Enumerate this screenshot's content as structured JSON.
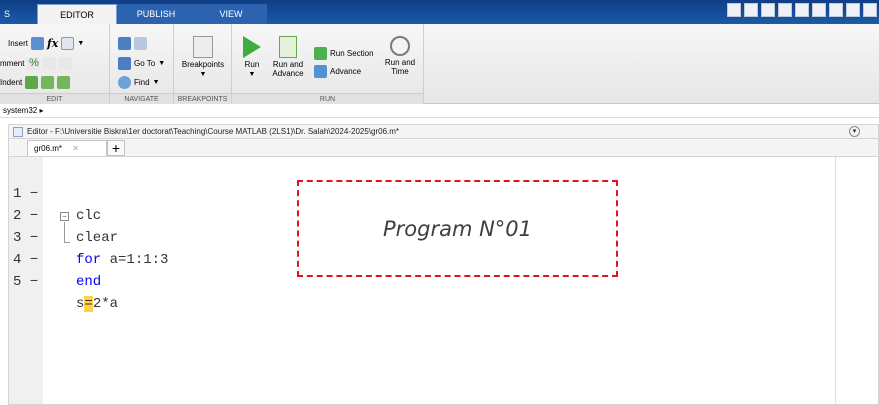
{
  "tabs": {
    "left_stub": "S",
    "editor": "EDITOR",
    "publish": "PUBLISH",
    "view": "VIEW"
  },
  "toolstrip": {
    "edit": {
      "label": "EDIT",
      "insert": "Insert",
      "fx": "fx",
      "comment": "mment",
      "indent": "Indent"
    },
    "navigate": {
      "label": "NAVIGATE",
      "goto": "Go To",
      "find": "Find"
    },
    "breakpoints": {
      "label": "BREAKPOINTS",
      "breakpoints": "Breakpoints"
    },
    "run": {
      "label": "RUN",
      "run": "Run",
      "run_and_advance_1": "Run and",
      "run_and_advance_2": "Advance",
      "run_section": "Run Section",
      "advance": "Advance",
      "run_and_time_1": "Run and",
      "run_and_time_2": "Time"
    }
  },
  "breadcrumb": "system32 ▸",
  "editor": {
    "title": "Editor - F:\\Universitie Biskra\\1er doctorat\\Teaching\\Course MATLAB (2LS1)\\Dr. Salah\\2024-2025\\gr06.m*",
    "tab_label": "gr06.m*",
    "tab_close": "✕",
    "new_tab": "+",
    "lines": [
      {
        "num": "1",
        "dash": "−",
        "text": "clc"
      },
      {
        "num": "2",
        "dash": "−",
        "text": "clear"
      },
      {
        "num": "3",
        "dash": "−",
        "kw": "for",
        "rest": " a=1:1:3"
      },
      {
        "num": "4",
        "dash": "−",
        "kw": "end"
      },
      {
        "num": "5",
        "dash": "−",
        "pre": "s",
        "hl": "=",
        "post": "2*a"
      }
    ]
  },
  "annotation": "Program N°01"
}
